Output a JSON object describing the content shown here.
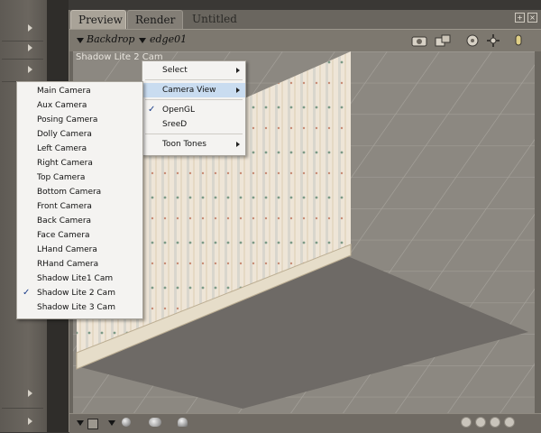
{
  "tabs": [
    {
      "label": "Preview"
    },
    {
      "label": "Render"
    }
  ],
  "doc_title": "Untitled",
  "toolbar": {
    "backdrop_label": "Backdrop",
    "object_label": "edge01"
  },
  "viewport": {
    "camera_label": "Shadow Lite 2 Cam"
  },
  "context_menu": {
    "items": [
      {
        "label": "Select",
        "submenu": true
      },
      {
        "label": "Camera View",
        "submenu": true,
        "highlighted": true
      },
      {
        "label": "OpenGL",
        "checked": true
      },
      {
        "label": "SreeD"
      },
      {
        "label": "Toon Tones",
        "submenu": true
      }
    ]
  },
  "camera_menu": {
    "items": [
      {
        "label": "Main Camera"
      },
      {
        "label": "Aux Camera"
      },
      {
        "label": "Posing Camera"
      },
      {
        "label": "Dolly Camera"
      },
      {
        "label": "Left Camera"
      },
      {
        "label": "Right Camera"
      },
      {
        "label": "Top Camera"
      },
      {
        "label": "Bottom Camera"
      },
      {
        "label": "Front Camera"
      },
      {
        "label": "Back Camera"
      },
      {
        "label": "Face Camera"
      },
      {
        "label": "LHand Camera"
      },
      {
        "label": "RHand Camera"
      },
      {
        "label": "Shadow Lite1 Cam"
      },
      {
        "label": "Shadow Lite 2 Cam",
        "checked": true
      },
      {
        "label": "Shadow Lite 3 Cam"
      }
    ]
  },
  "colors": {
    "highlight": "#c9dcf0",
    "floor": "#8c8881",
    "shadow": "#6e6a66",
    "wall": "#ece3d4"
  }
}
